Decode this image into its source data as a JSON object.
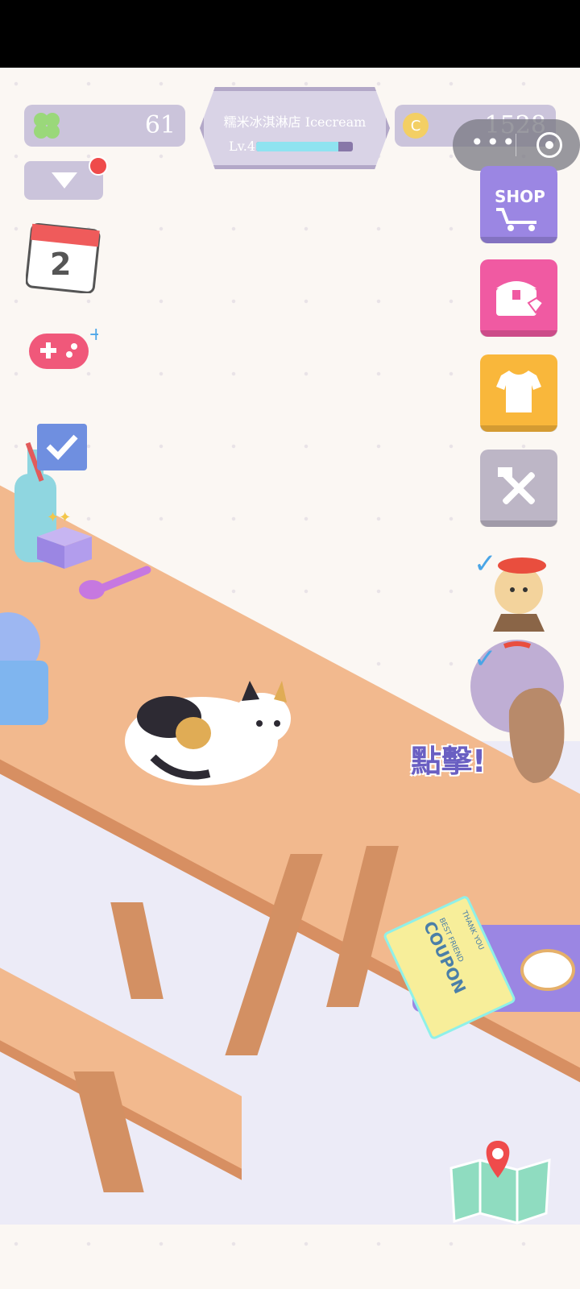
{
  "hud": {
    "clover_count": "61",
    "coin_count": "1528",
    "shop_name": "糯米冰淇淋店 Icecream",
    "level_label": "Lv.4",
    "level_progress": 0.85
  },
  "mini_program": {
    "more_glyph": "•••"
  },
  "right_buttons": {
    "shop_label": "SHOP",
    "shop_color": "#9b86e3",
    "chest_color": "#f05aa2",
    "clothes_color": "#f9b73b",
    "tools_color": "#bdb6c6"
  },
  "calendar": {
    "day": "2"
  },
  "tap_hint": "點擊!",
  "coupon": {
    "line1": "BEST FRIEND",
    "line2": "COUPON",
    "line3": "THANK YOU"
  },
  "icons": [
    "clover-icon",
    "coin-icon",
    "dropdown-icon",
    "calendar-icon",
    "gamepad-icon",
    "checklist-icon",
    "gift-box-icon",
    "shop-cart-icon",
    "treasure-chest-icon",
    "tshirt-icon",
    "tools-icon",
    "map-icon",
    "diamond-icon"
  ]
}
